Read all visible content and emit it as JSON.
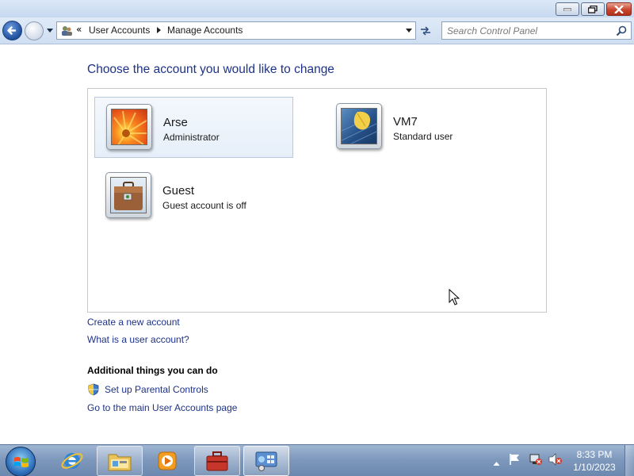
{
  "window": {
    "minimize_icon": "minimize-icon",
    "restore_icon": "restore-icon",
    "close_icon": "close-icon"
  },
  "nav": {
    "breadcrumb_chevron": "«",
    "breadcrumbs": [
      "User Accounts",
      "Manage Accounts"
    ],
    "search_placeholder": "Search Control Panel"
  },
  "main": {
    "heading": "Choose the account you would like to change",
    "accounts": [
      {
        "name": "Arse",
        "type": "Administrator",
        "picture": "flower-picture",
        "selected": true
      },
      {
        "name": "VM7",
        "type": "Standard user",
        "picture": "leaf-picture",
        "selected": false
      },
      {
        "name": "Guest",
        "type": "Guest account is off",
        "picture": "suitcase-picture",
        "selected": false
      }
    ],
    "links": {
      "create": "Create a new account",
      "what_is": "What is a user account?"
    },
    "additional": {
      "title": "Additional things you can do",
      "parental": "Set up Parental Controls",
      "main_page": "Go to the main User Accounts page"
    }
  },
  "taskbar": {
    "items": [
      "internet-explorer",
      "windows-explorer",
      "media-player",
      "control-panel-toolbox",
      "user-accounts-window"
    ],
    "clock_time": "8:33 PM",
    "clock_date": "1/10/2023"
  },
  "colors": {
    "link": "#1e3287",
    "heading": "#1e3287",
    "selected_tile": "#e6eff9"
  }
}
